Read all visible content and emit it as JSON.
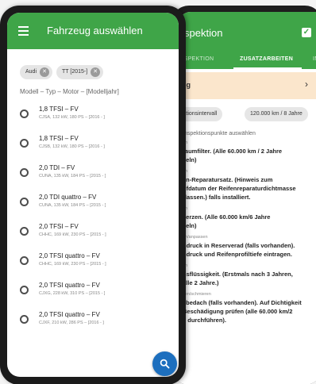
{
  "back_screen": {
    "title": "spektion",
    "tabs": [
      "INSPEKTION",
      "ZUSATZARBEITEN",
      "IN"
    ],
    "warning_text": "ig",
    "chevron": "›",
    "chips": [
      "ektionsintervall",
      "120.000 km / 8 Jahre"
    ],
    "section_label": "Inspektionspunkte auswählen",
    "items": [
      {
        "category": "en",
        "lines": [
          "raumfilter. (Alle 60.000 km / 2 Jahre",
          "seln)"
        ]
      },
      {
        "category": "en",
        "lines": [
          "en-Reparatursatz. (Hinweis zum",
          "ufdatum der Reifenreparaturdichtmasse",
          "rlassen.) falls installiert."
        ]
      },
      {
        "category": "en",
        "lines": [
          "kerzen. (Alle 60.000 km/6 Jahre",
          "seln)"
        ]
      },
      {
        "category": "en/anpassen",
        "lines": [
          "ndruck in Reserverad (falls vorhanden).",
          "ndruck und Reifenprofiltiefe eintragen."
        ]
      },
      {
        "category": "en",
        "lines": [
          "nsflüssigkeit. (Erstmals nach 3 Jahren,",
          "alle 2 Jahre.)"
        ]
      },
      {
        "category": "sen/schmieren",
        "lines": [
          "ebedach (falls vorhanden). Auf Dichtigkeit",
          "Beschädigung prüfen (alle 60.000 km/2",
          "e durchführen)."
        ]
      }
    ]
  },
  "front_screen": {
    "title": "Fahrzeug auswählen",
    "chips": [
      "Audi",
      "TT [2015-]"
    ],
    "chip_close": "✕",
    "list_header": "Modell – Typ – Motor – [Modelljahr]",
    "models": [
      {
        "title": "1,8 TFSI – FV",
        "sub": "CJSA, 132 kW, 180 PS – [2016 - ]"
      },
      {
        "title": "1,8 TFSI – FV",
        "sub": "CJSB, 132 kW, 180 PS – [2016 - ]"
      },
      {
        "title": "2,0 TDI – FV",
        "sub": "CUNA, 135 kW, 184 PS – [2015 - ]"
      },
      {
        "title": "2,0 TDI quattro – FV",
        "sub": "CUNA, 135 kW, 184 PS – [2015 - ]"
      },
      {
        "title": "2,0 TFSI – FV",
        "sub": "CHHC, 169 kW, 230 PS – [2015 - ]"
      },
      {
        "title": "2,0 TFSI quattro – FV",
        "sub": "CHHC, 169 kW, 230 PS – [2015 - ]"
      },
      {
        "title": "2,0 TFSI quattro – FV",
        "sub": "CJXG, 228 kW, 310 PS – [2015 - ]"
      },
      {
        "title": "2,0 TFSI quattro – FV",
        "sub": "CJXF, 210 kW, 286 PS – [2016 - ]"
      }
    ]
  },
  "colors": {
    "primary": "#3fa548",
    "fab": "#1d6fbe",
    "warning_bg": "#fbe6cc"
  },
  "icons": {
    "menu": "menu-icon",
    "search": "search-icon",
    "check": "check-icon",
    "close": "close-icon"
  }
}
